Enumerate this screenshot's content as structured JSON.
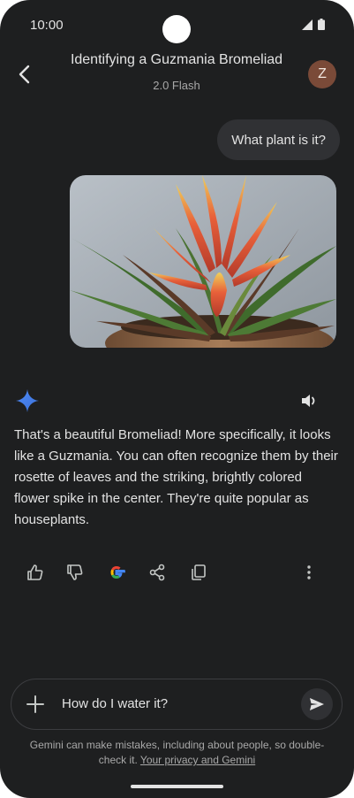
{
  "status_bar": {
    "time": "10:00"
  },
  "header": {
    "title": "Identifying a Guzmania Bromeliad",
    "model": "2.0 Flash",
    "avatar_initial": "Z"
  },
  "conversation": {
    "user_message": "What plant is it?",
    "assistant_reply": "That's a beautiful Bromeliad! More specifically, it looks like a Guzmania. You can often recognize them by their rosette of leaves and the striking, brightly colored flower spike in the center. They're quite popular as houseplants."
  },
  "composer": {
    "text": "How do I water it?"
  },
  "footer": {
    "disclaimer": "Gemini can make mistakes, including about people, so double-check it.",
    "privacy_link": "Your privacy and Gemini"
  },
  "colors": {
    "background": "#1e1f20",
    "bubble": "#303134",
    "gemini_blue": "#4285f4"
  },
  "icons": [
    "back-arrow-icon",
    "gemini-sparkle-icon",
    "speaker-icon",
    "thumbs-up-icon",
    "thumbs-down-icon",
    "google-icon",
    "share-icon",
    "copy-icon",
    "more-vert-icon",
    "plus-icon",
    "send-icon"
  ]
}
